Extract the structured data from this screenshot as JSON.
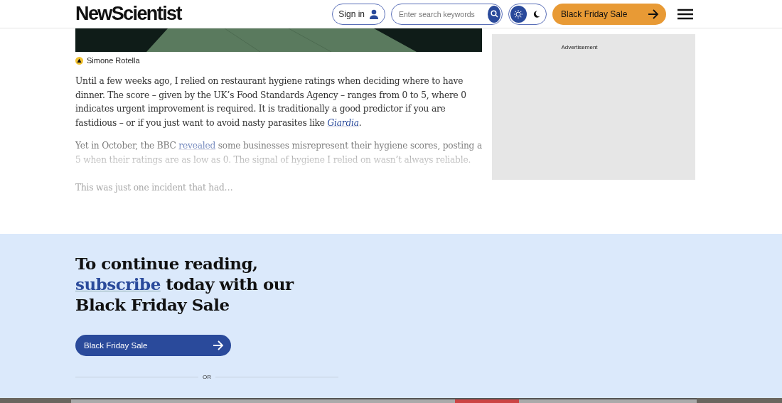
{
  "header": {
    "logo": "NewScientist",
    "sign_in": "Sign in",
    "search": {
      "placeholder": "Enter search keywords"
    },
    "theme_toggle": {
      "dark": false
    },
    "sale_button": "Black Friday Sale"
  },
  "article": {
    "credit": "Simone Rotella",
    "paragraphs": [
      "Until a few weeks ago, I relied on restaurant hygiene ratings when deciding where to have dinner. The score – given by the UK’s Food Standards Agency – ranges from 0 to 5, where 0 indicates urgent improvement is required. It is traditionally a good predictor if you are fastidious – or if you just want to avoid nasty parasites like *Giardia*.",
      "Yet in October, the BBC revealed some businesses misrepresent their hygiene scores, posting a 5 when their ratings are as low as 0. The signal of hygiene I relied on wasn’t always reliable.",
      "This was just one incident that had…"
    ]
  },
  "advert": {
    "label": "Advertisement"
  },
  "paywall": {
    "heading_before": "To continue reading,",
    "heading_link": "subscribe",
    "heading_after": "today with our Black Friday Sale",
    "button": "Black Friday Sale",
    "divider": "OR"
  }
}
